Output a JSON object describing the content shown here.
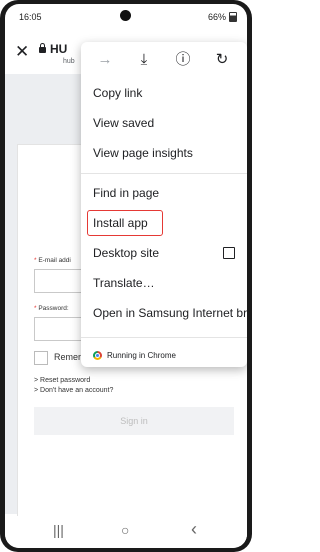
{
  "status": {
    "time": "16:05",
    "battery": "66%"
  },
  "urlbar": {
    "title": "HU",
    "subtitle": "hub"
  },
  "toolbar_icons": [
    "forward-icon",
    "download-icon",
    "info-icon",
    "reload-icon"
  ],
  "menu": {
    "items": [
      {
        "label": "Copy link"
      },
      {
        "label": "View saved"
      },
      {
        "label": "View page insights"
      },
      {
        "label": "Find in page"
      },
      {
        "label": "Install app",
        "highlighted": true
      },
      {
        "label": "Desktop site",
        "checkbox": false
      },
      {
        "label": "Translate…"
      },
      {
        "label": "Open in Samsung Internet br..."
      }
    ],
    "footer": "Running in Chrome"
  },
  "form": {
    "email_label": "E-mail addi",
    "password_label": "Password:",
    "remember_label": "Remer",
    "reset_link": "Reset password",
    "account_link": "Don't have an account?",
    "signin_button": "Sign in"
  },
  "navbar": {
    "recents": "|||",
    "home": "○",
    "back": "‹"
  },
  "colors": {
    "highlight": "#e53935",
    "disabled_button": "#f1f2f4"
  }
}
